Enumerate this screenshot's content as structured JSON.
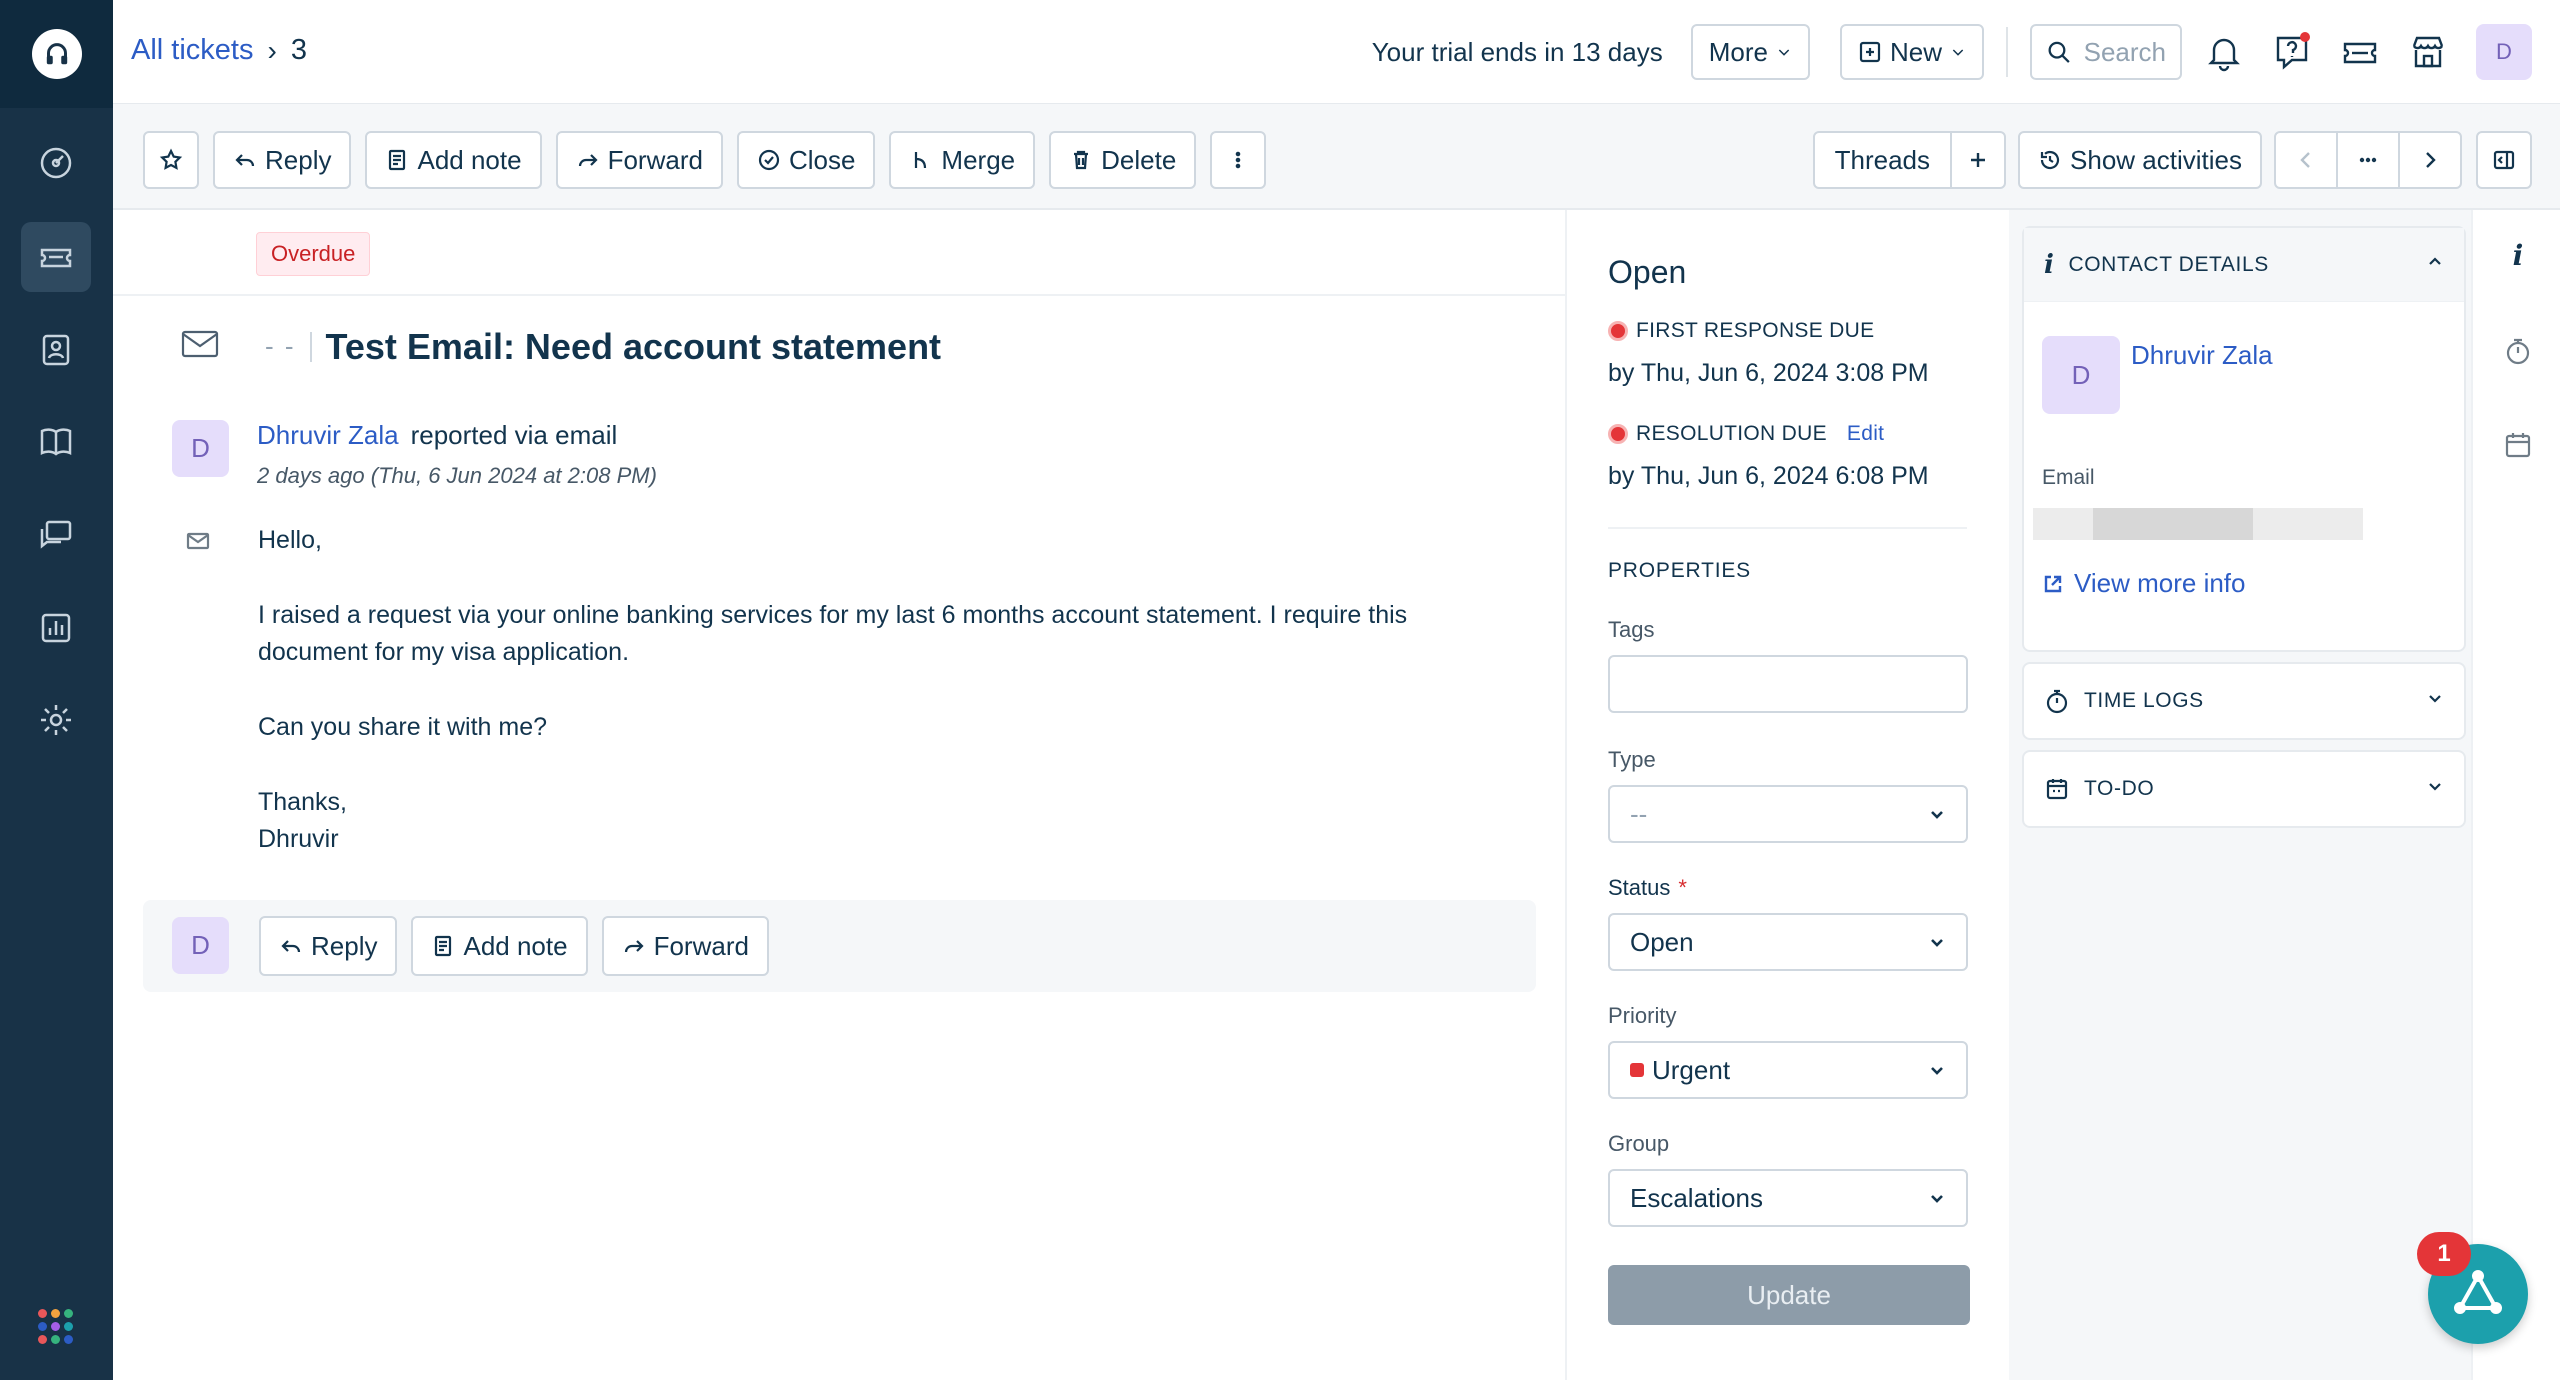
{
  "nav": {
    "items": [
      "dashboard",
      "tickets",
      "contacts",
      "solutions",
      "forums",
      "reports",
      "admin"
    ]
  },
  "breadcrumb": {
    "root": "All tickets",
    "current": "3"
  },
  "topbar": {
    "trial": "Your trial ends in 13 days",
    "more": "More",
    "new": "New",
    "search_placeholder": "Search",
    "avatar": "D"
  },
  "toolbar": {
    "reply": "Reply",
    "add_note": "Add note",
    "forward": "Forward",
    "close": "Close",
    "merge": "Merge",
    "delete": "Delete",
    "threads": "Threads",
    "show_activities": "Show activities"
  },
  "ticket": {
    "badge": "Overdue",
    "subject_prefix": "- -",
    "subject": "Test Email: Need account statement",
    "requester": "Dhruvir Zala",
    "reported_via": "reported via email",
    "time": "2 days ago (Thu, 6 Jun 2024 at 2:08 PM)",
    "avatar": "D",
    "body": [
      "Hello,",
      "I raised a request via your online banking services for my last 6 months account statement. I require this document for my visa application.",
      "Can you share it with me?",
      "Thanks,",
      "Dhruvir"
    ]
  },
  "replybar": {
    "avatar": "D",
    "reply": "Reply",
    "add_note": "Add note",
    "forward": "Forward"
  },
  "properties": {
    "status_title": "Open",
    "first_response_label": "FIRST RESPONSE DUE",
    "first_response_value": "by Thu, Jun 6, 2024 3:08 PM",
    "resolution_label": "RESOLUTION DUE",
    "resolution_edit": "Edit",
    "resolution_value": "by Thu, Jun 6, 2024 6:08 PM",
    "heading": "PROPERTIES",
    "tags_label": "Tags",
    "tags_value": "",
    "type_label": "Type",
    "type_value": "--",
    "status_label": "Status",
    "status_required": "*",
    "status_value": "Open",
    "priority_label": "Priority",
    "priority_value": "Urgent",
    "priority_color": "#e43538",
    "group_label": "Group",
    "group_value": "Escalations",
    "update": "Update"
  },
  "sidebar": {
    "contact_title": "CONTACT DETAILS",
    "contact_avatar": "D",
    "contact_name": "Dhruvir Zala",
    "email_label": "Email",
    "view_more": "View more info",
    "time_logs": "TIME LOGS",
    "todo": "TO-DO"
  },
  "fab": {
    "badge": "1"
  },
  "colors": {
    "nav_bg": "#183247",
    "link": "#2c5cc5",
    "danger": "#e43538",
    "teal": "#1ca0ac"
  }
}
